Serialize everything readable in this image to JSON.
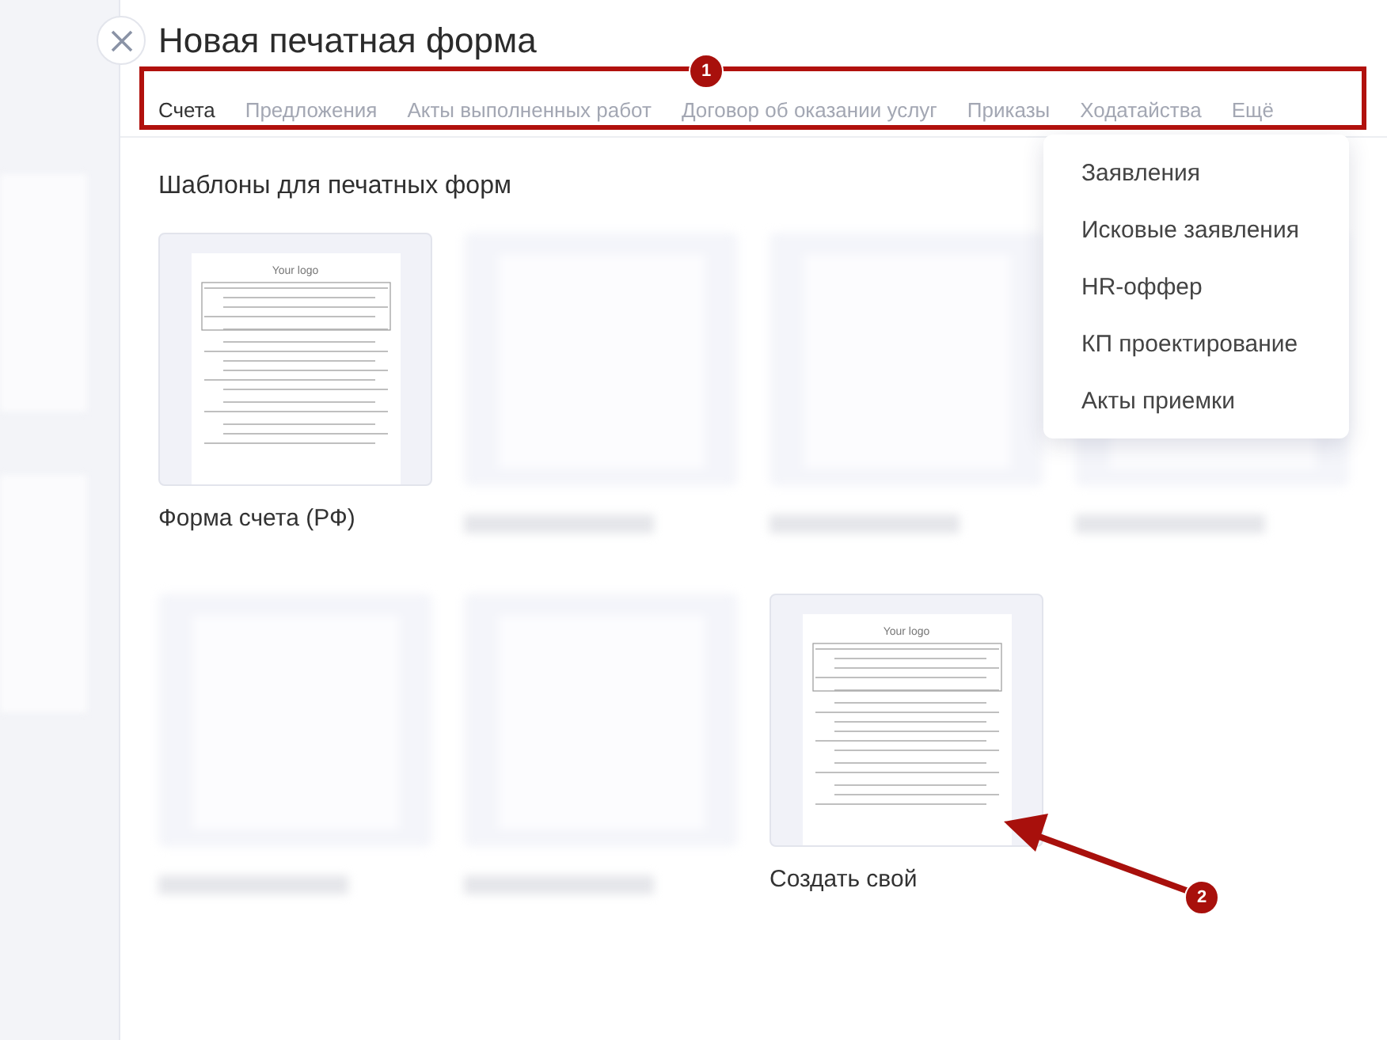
{
  "title": "Новая печатная форма",
  "tabs": [
    {
      "label": "Счета",
      "selected": true
    },
    {
      "label": "Предложения",
      "selected": false
    },
    {
      "label": "Акты выполненных работ",
      "selected": false
    },
    {
      "label": "Договор об оказании услуг",
      "selected": false
    },
    {
      "label": "Приказы",
      "selected": false
    },
    {
      "label": "Ходатайства",
      "selected": false
    }
  ],
  "more_tab": "Ещё",
  "section_title": "Шаблоны для печатных форм",
  "templates": [
    {
      "kind": "preview",
      "label": "Форма счета (РФ)",
      "logo": "Your logo"
    },
    {
      "kind": "blurred"
    },
    {
      "kind": "blurred"
    },
    {
      "kind": "blurred"
    },
    {
      "kind": "blurred"
    },
    {
      "kind": "blurred"
    },
    {
      "kind": "preview",
      "label": "Создать свой",
      "logo": "Your logo"
    }
  ],
  "dropdown": [
    "Заявления",
    "Исковые заявления",
    "HR-оффер",
    "КП проектирование",
    "Акты приемки"
  ],
  "annotations": [
    {
      "kind": "box",
      "number": "1"
    },
    {
      "kind": "arrow",
      "number": "2"
    }
  ]
}
